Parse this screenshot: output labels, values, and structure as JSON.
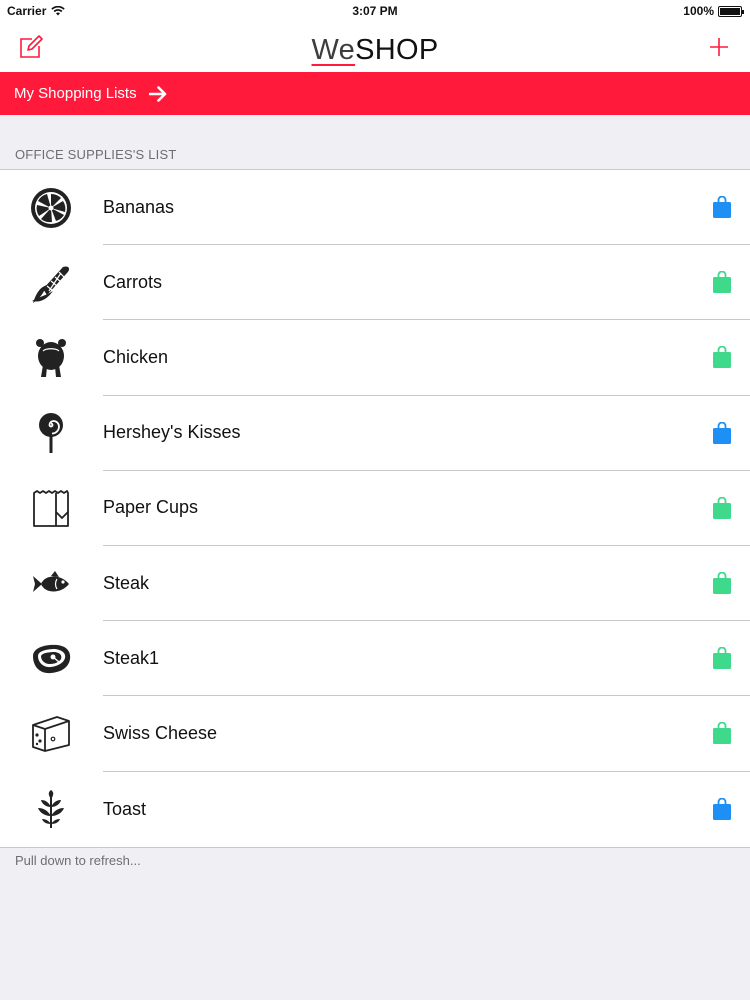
{
  "status_bar": {
    "carrier": "Carrier",
    "time": "3:07 PM",
    "battery": "100%"
  },
  "nav": {
    "title_we": "We",
    "title_shop": "SHOP"
  },
  "banner": {
    "label": "My Shopping Lists"
  },
  "section": {
    "header": "OFFICE SUPPLIES'S LIST"
  },
  "colors": {
    "accent": "#ff1a3b",
    "bag_blue": "#1e8ff5",
    "bag_green": "#3ed98b"
  },
  "items": [
    {
      "label": "Bananas",
      "icon": "citrus-slice-icon",
      "bag": "blue"
    },
    {
      "label": "Carrots",
      "icon": "corn-icon",
      "bag": "green"
    },
    {
      "label": "Chicken",
      "icon": "roast-chicken-icon",
      "bag": "green"
    },
    {
      "label": "Hershey's Kisses",
      "icon": "lollipop-icon",
      "bag": "blue"
    },
    {
      "label": "Paper Cups",
      "icon": "paper-bag-icon",
      "bag": "green"
    },
    {
      "label": "Steak",
      "icon": "fish-icon",
      "bag": "green"
    },
    {
      "label": "Steak1",
      "icon": "steak-icon",
      "bag": "green"
    },
    {
      "label": "Swiss Cheese",
      "icon": "cheese-icon",
      "bag": "green"
    },
    {
      "label": "Toast",
      "icon": "herb-icon",
      "bag": "blue"
    }
  ],
  "footer": {
    "text": "Pull down to refresh..."
  }
}
